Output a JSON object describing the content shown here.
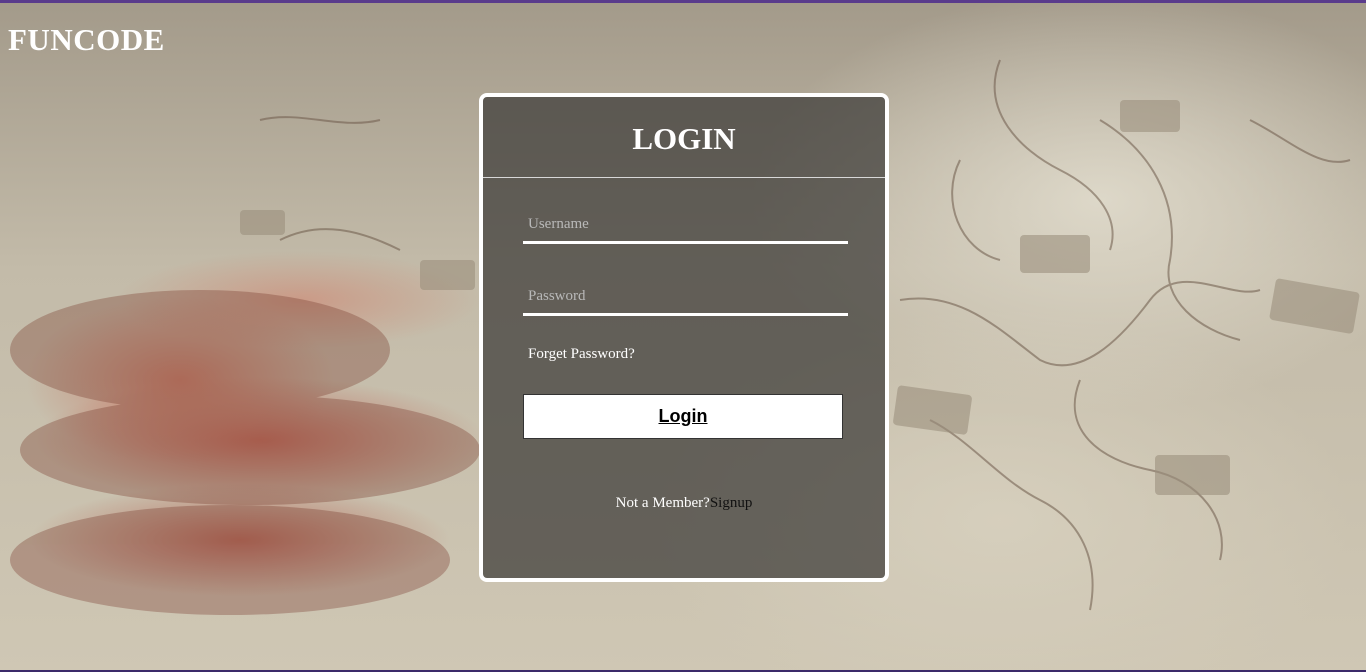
{
  "brand": {
    "name": "FUNCODE"
  },
  "login_card": {
    "title": "LOGIN",
    "username_placeholder": "Username",
    "password_placeholder": "Password",
    "forgot_password": "Forget Password?",
    "login_button": "Login",
    "not_member_text": "Not a Member?",
    "signup_link": "Signup"
  },
  "colors": {
    "accent_bar": "#5a3b8c",
    "card_border": "#ffffff",
    "card_background": "rgba(60,58,55,0.72)",
    "text_primary": "#ffffff",
    "signup_link": "#111111"
  },
  "background": {
    "image": "blurred-hand-jigsaw-puzzle"
  }
}
